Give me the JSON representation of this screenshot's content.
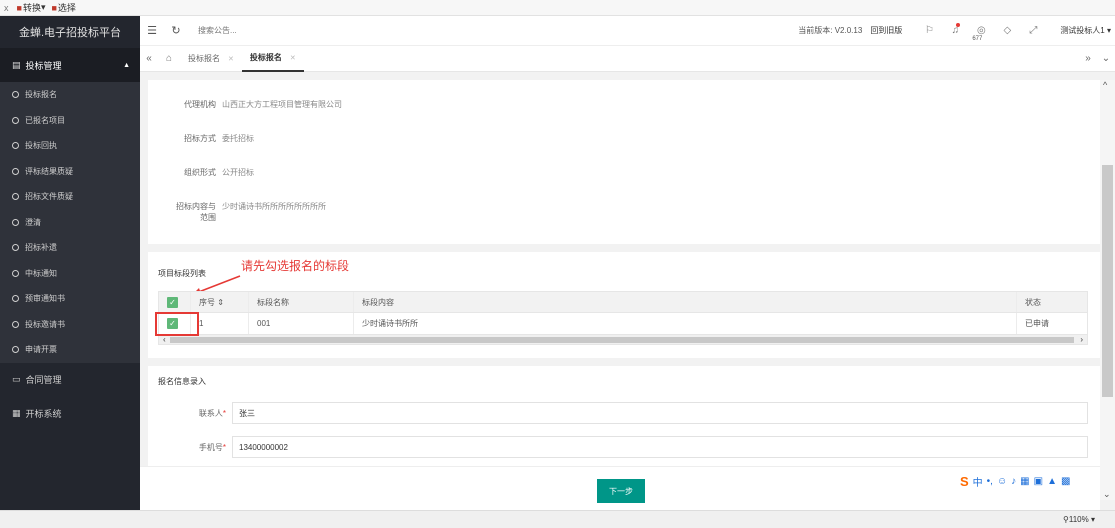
{
  "browser": {
    "close_glyph": "x",
    "tools": [
      {
        "icon": "convert-icon",
        "label": "转换",
        "arrow": "▾"
      },
      {
        "icon": "select-icon",
        "label": "选择"
      }
    ]
  },
  "sidebar": {
    "brand": "金蝉.电子招投标平台",
    "group": {
      "label": "投标管理",
      "icon": "document-icon"
    },
    "items": [
      {
        "label": "投标报名"
      },
      {
        "label": "已报名项目"
      },
      {
        "label": "投标回执"
      },
      {
        "label": "评标结果质疑"
      },
      {
        "label": "招标文件质疑"
      },
      {
        "label": "澄清"
      },
      {
        "label": "招标补遗"
      },
      {
        "label": "中标通知"
      },
      {
        "label": "预审通知书"
      },
      {
        "label": "投标邀请书"
      },
      {
        "label": "申请开票"
      }
    ],
    "other_groups": [
      {
        "label": "合同管理",
        "icon": "contract-icon"
      },
      {
        "label": "开标系统",
        "icon": "bid-opening-icon"
      }
    ]
  },
  "header": {
    "search_placeholder": "搜索公告...",
    "version": "当前版本: V2.0.13",
    "old_version_link": "回到旧版",
    "notice_count": "677",
    "user": "测试投标人1 ▾"
  },
  "tabs": [
    {
      "label": "投标报名",
      "active": false
    },
    {
      "label": "投标报名",
      "active": true
    }
  ],
  "project_info": [
    {
      "label": "代理机构",
      "value": "山西正大方工程项目管理有限公司"
    },
    {
      "label": "招标方式",
      "value": "委托招标"
    },
    {
      "label": "组织形式",
      "value": "公开招标"
    },
    {
      "label": "招标内容与范围",
      "label_line1": "招标内容与",
      "label_line2": "范围",
      "value": "少时诵诗书所所所所所所所所"
    }
  ],
  "sections": {
    "list_title": "项目标段列表",
    "hint": "请先勾选报名的标段",
    "form_title": "报名信息录入"
  },
  "grid": {
    "columns": [
      "序号",
      "标段名称",
      "标段内容",
      "状态"
    ],
    "sort_glyph": "⇕",
    "rows": [
      {
        "no": "1",
        "name": "001",
        "content": "少时诵诗书所所",
        "status": "已申请",
        "checked": true
      }
    ]
  },
  "form": {
    "contact_label": "联系人",
    "contact_value": "张三",
    "phone_label": "手机号",
    "phone_value": "13400000002",
    "required_mark": "*"
  },
  "footer": {
    "next_label": "下一步"
  },
  "status": {
    "zoom": "110%"
  },
  "colors": {
    "accent": "#009688",
    "check": "#5fb878",
    "hint": "#e53935",
    "sidebar": "#23262e"
  }
}
